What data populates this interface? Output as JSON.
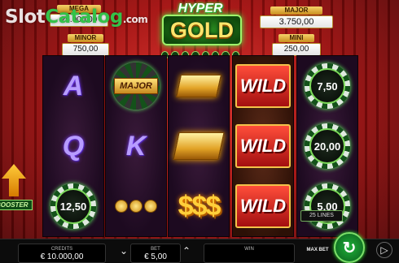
{
  "watermark": {
    "part1": "Slot",
    "part2": "Catalog",
    "suffix": ".com"
  },
  "jackpots": {
    "mega": {
      "label": "MEGA",
      "value": "25.000,00"
    },
    "minor": {
      "label": "MINOR",
      "value": "750,00"
    },
    "major": {
      "label": "MAJOR",
      "value": "3.750,00"
    },
    "mini": {
      "label": "MINI",
      "value": "250,00"
    }
  },
  "logo": {
    "line1": "HYPER",
    "line2": "GOLD"
  },
  "reels": {
    "r1": {
      "top": "A",
      "mid": "Q",
      "chip": "12,50"
    },
    "r2": {
      "top": "MAJOR",
      "mid": "K"
    },
    "r3": {
      "bot": "$$$"
    },
    "r4": {
      "w1": "WILD",
      "w2": "WILD",
      "w3": "WILD"
    },
    "r5": {
      "c1": "7,50",
      "c2": "20,00",
      "c3": "5,00"
    }
  },
  "booster": {
    "label": "BOOSTER"
  },
  "lines_label": "25 LINES",
  "bottom": {
    "credits_label": "CREDITS",
    "credits_value": "€ 10.000,00",
    "bet_label": "BET",
    "bet_value": "€ 5,00",
    "win_label": "WIN",
    "win_value": "",
    "maxbet_label": "MAX BET",
    "bet_down": "⌄",
    "bet_up": "⌃",
    "spin": "↻",
    "autoplay": "▷"
  },
  "colors": {
    "accent_green": "#2fb03d",
    "gold": "#f3c24a",
    "bg_red": "#b31310"
  }
}
